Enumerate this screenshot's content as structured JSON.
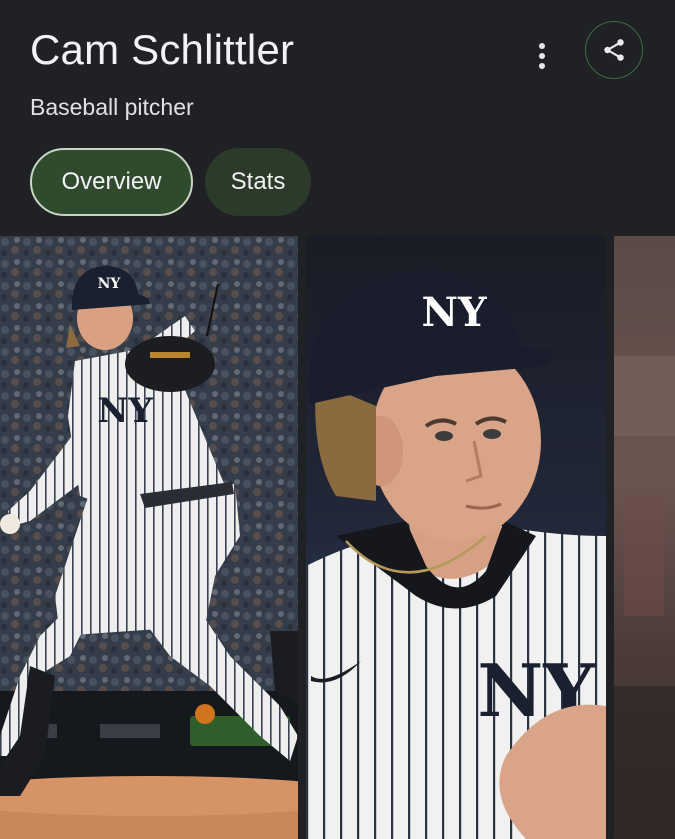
{
  "header": {
    "title": "Cam Schlittler",
    "subtitle": "Baseball pitcher"
  },
  "actions": {
    "more_icon": "more-vert-icon",
    "share_icon": "share-icon"
  },
  "tabs": [
    {
      "label": "Overview",
      "selected": true
    },
    {
      "label": "Stats",
      "selected": false
    }
  ],
  "colors": {
    "background": "#202124",
    "selected_tab": "#2f4a2c",
    "selected_tab_border": "#c7d6c2",
    "tab": "#2c3a29",
    "share_border": "#3e6b46"
  },
  "gallery": {
    "images": [
      {
        "subject": "pitcher delivering a pitch in pinstripe uniform"
      },
      {
        "subject": "player close-up in navy NY cap and pinstripe jersey"
      },
      {
        "subject": "partially visible image"
      }
    ],
    "cap_logo": "NY"
  }
}
